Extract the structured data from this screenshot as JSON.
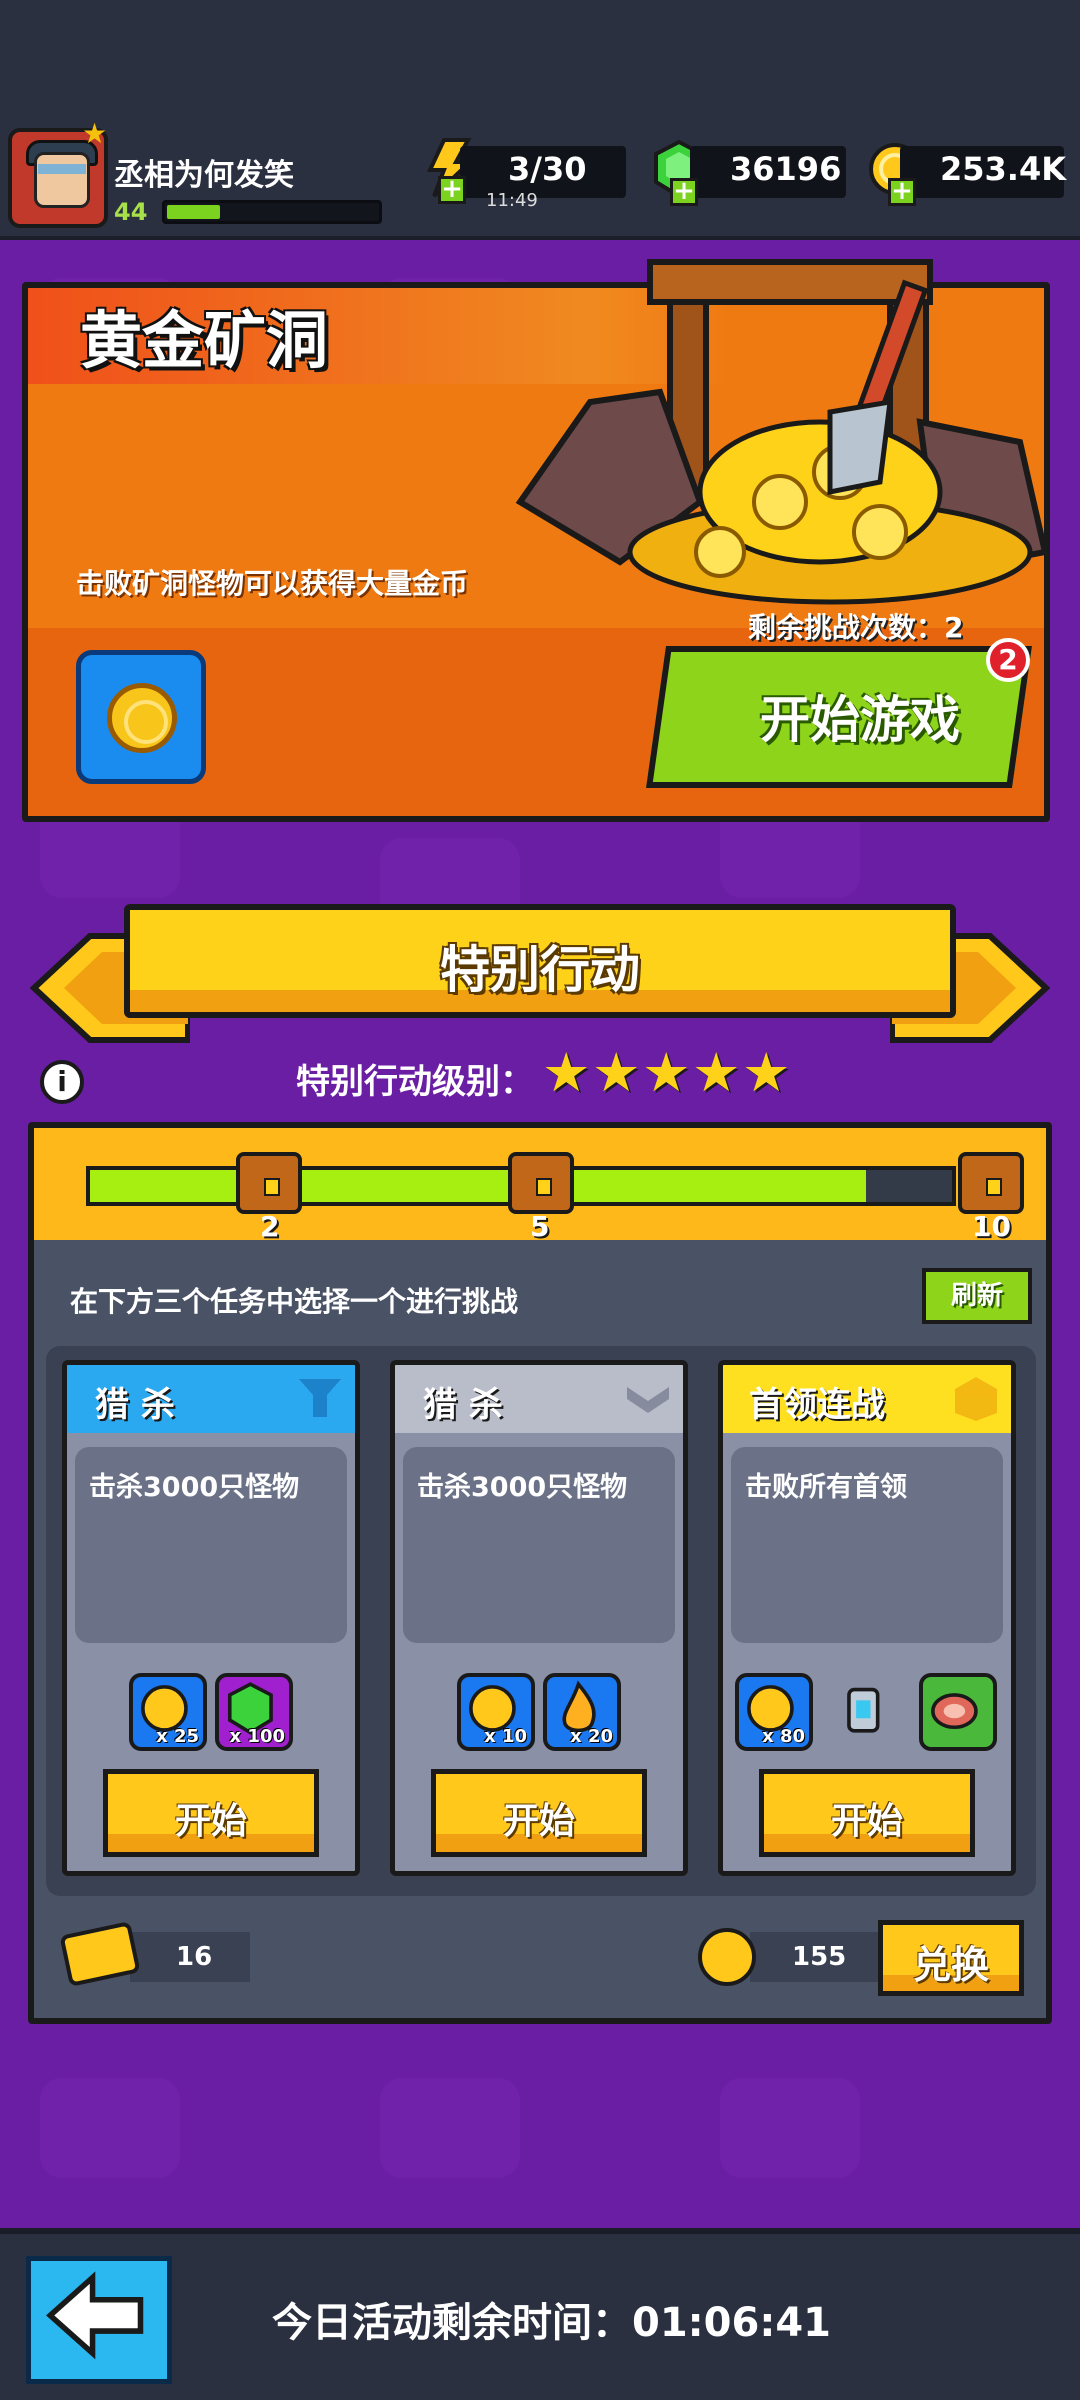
{
  "header": {
    "player_name": "丞相为何发笑",
    "level": "44",
    "xp_progress": 0.25,
    "energy": "3/30",
    "energy_timer": "11:49",
    "gems": "36196",
    "coins": "253.4K"
  },
  "gold_mine": {
    "title": "黄金矿洞",
    "description": "击败矿洞怪物可以获得大量金币",
    "remaining": "剩余挑战次数：2",
    "start_label": "开始游戏",
    "badge": "2"
  },
  "special_action": {
    "title": "特别行动",
    "level_label": "特别行动级别：",
    "stars": 5,
    "progress_fraction": 0.9,
    "milestones": [
      "2",
      "5",
      "10"
    ],
    "instruction": "在下方三个任务中选择一个进行挑战",
    "refresh_label": "刷新",
    "cards": [
      {
        "title": "猎 杀",
        "description": "击杀3000只怪物",
        "start_label": "开始",
        "head_color": "#2aa8f0",
        "rewards": [
          {
            "icon": "coin-icon",
            "qty": "x 25"
          },
          {
            "icon": "gem-icon",
            "qty": "x 100"
          }
        ]
      },
      {
        "title": "猎 杀",
        "description": "击杀3000只怪物",
        "start_label": "开始",
        "head_color": "#b8bdc9",
        "rewards": [
          {
            "icon": "coin-icon",
            "qty": "x 10"
          },
          {
            "icon": "flame-icon",
            "qty": "x 20"
          }
        ]
      },
      {
        "title": "首领连战",
        "description": "击败所有首领",
        "start_label": "开始",
        "head_color": "#ffe020",
        "rewards": [
          {
            "icon": "coin-icon",
            "qty": "x 80"
          },
          {
            "icon": "armor-icon",
            "qty": ""
          },
          {
            "icon": "meat-icon",
            "qty": ""
          }
        ]
      }
    ],
    "tickets": "16",
    "tokens": "155",
    "exchange_label": "兑换"
  },
  "footer": {
    "countdown": "今日活动剩余时间：01:06:41"
  }
}
